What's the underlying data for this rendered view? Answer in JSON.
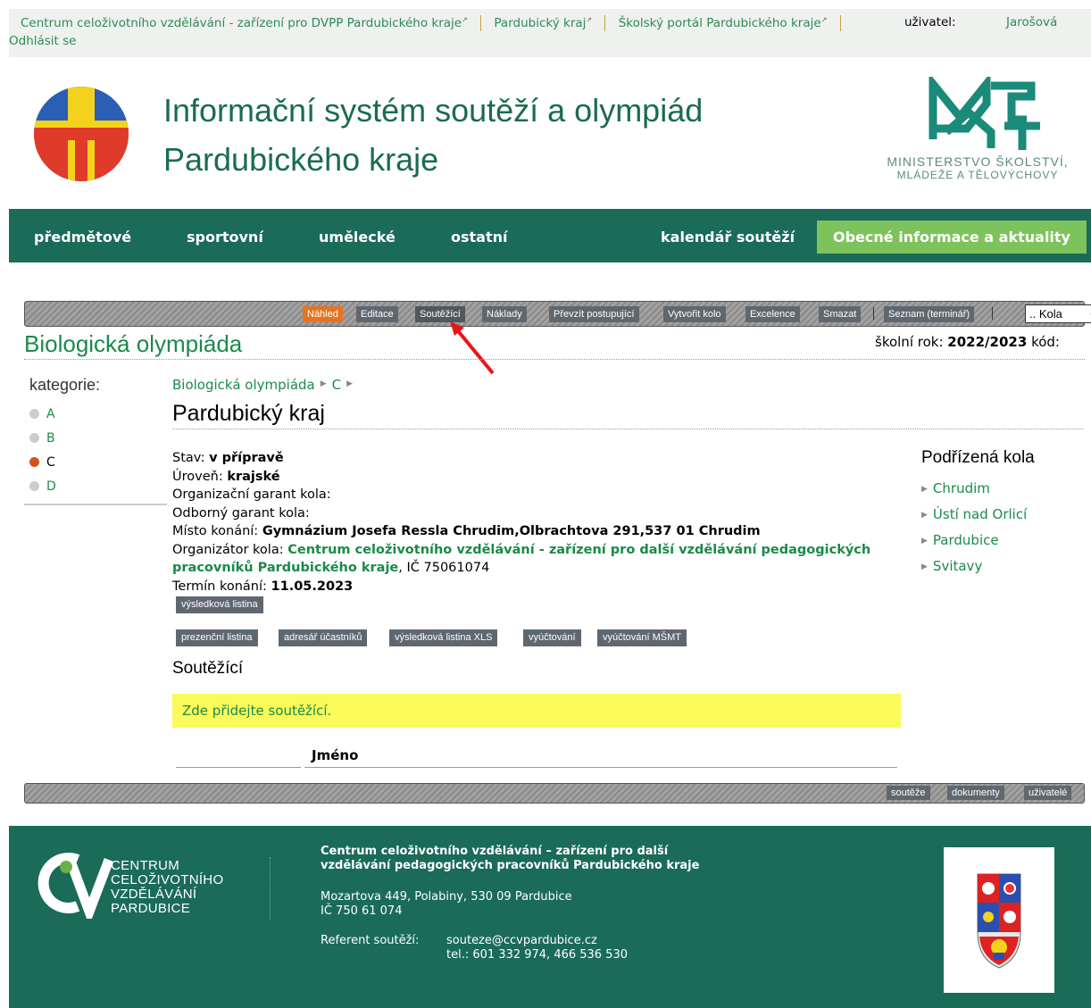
{
  "topbar": {
    "link1": "Centrum celoživotního vzdělávání - zařízení pro DVPP Pardubického kraje",
    "link2": "Pardubický kraj",
    "link3": "Školský portál Pardubického kraje",
    "user_label": "uživatel:",
    "user_name": "Jarošová",
    "logout": "Odhlásit se"
  },
  "header": {
    "title_line1": "Informační systém soutěží a olympiád",
    "title_line2": "Pardubického kraje",
    "msmt_line1": "MINISTERSTVO ŠKOLSTVÍ,",
    "msmt_line2": "MLÁDEŽE A TĚLOVÝCHOVY"
  },
  "nav": {
    "items": [
      "předmětové",
      "sportovní",
      "umělecké",
      "ostatní",
      "kalendář soutěží"
    ],
    "highlight": "Obecné informace a aktuality"
  },
  "toolbar": {
    "buttons": [
      "Náhled",
      "Editace",
      "Soutěžící",
      "Náklady",
      "Převzít postupující",
      "Vytvořit kolo",
      "Excelence",
      "Smazat",
      "Seznam (terminář)"
    ],
    "select_value": ".. Kola"
  },
  "page": {
    "title": "Biologická olympiáda",
    "school_year_label": "školní rok:",
    "school_year": "2022/2023",
    "code_label": "kód:"
  },
  "categories": {
    "title": "kategorie:",
    "items": [
      "A",
      "B",
      "C",
      "D"
    ],
    "active": "C"
  },
  "breadcrumb": {
    "item1": "Biologická olympiáda",
    "item2": "C"
  },
  "region": {
    "title": "Pardubický kraj"
  },
  "info": {
    "stav_label": "Stav:",
    "stav": "v přípravě",
    "uroven_label": "Úroveň:",
    "uroven": "krajské",
    "org_garant": "Organizační garant kola:",
    "odb_garant": "Odborný garant kola:",
    "misto_label": "Místo konání:",
    "misto": "Gymnázium Josefa Ressla Chrudim,Olbrachtova 291,537 01 Chrudim",
    "organizator_label": "Organizátor kola:",
    "organizator": "Centrum celoživotního vzdělávání - zařízení pro další vzdělávání pedagogických pracovníků Pardubického kraje",
    "ic": ", IČ 75061074",
    "termin_label": "Termín konání:",
    "termin": "11.05.2023"
  },
  "doc_buttons": {
    "vysledkova": "výsledková listina",
    "row": [
      "prezenční listina",
      "adresář účastníků",
      "výsledková listina XLS",
      "vyúčtování",
      "vyúčtování MŠMT"
    ]
  },
  "subrounds": {
    "title": "Podřízená kola",
    "items": [
      "Chrudim",
      "Ústí nad Orlicí",
      "Pardubice",
      "Svitavy"
    ]
  },
  "competitors": {
    "title": "Soutěžící",
    "notice": "Zde přidejte soutěžící.",
    "column_name": "Jméno"
  },
  "bottombar": {
    "buttons": [
      "soutěže",
      "dokumenty",
      "uživatelé"
    ]
  },
  "footer": {
    "logo_lines": [
      "CENTRUM",
      "CELOŽIVOTNÍHO",
      "VZDĚLÁVÁNÍ",
      "PARDUBICE"
    ],
    "org_line1": "Centrum celoživotního vzdělávání – zařízení pro další",
    "org_line2": "vzdělávání pedagogických pracovníků Pardubického kraje",
    "addr_line1": "Mozartova 449, Polabiny, 530 09 Pardubice",
    "addr_line2": "IČ 750 61 074",
    "ref_label": "Referent soutěží:",
    "ref_email": "souteze@ccvpardubice.cz",
    "ref_phone": "tel.: 601 332 974, 466 536 530"
  },
  "colors": {
    "brand_green": "#1a6b58",
    "link_green": "#1a8a4a",
    "highlight_green": "#7dc35b",
    "active_orange": "#e8731f",
    "notice_yellow": "#fafa5a"
  },
  "icons": [
    "external-link-icon",
    "dropdown-chevron-icon",
    "triangle-bullet-icon",
    "category-dot-icon",
    "arrow-annotation-icon"
  ]
}
